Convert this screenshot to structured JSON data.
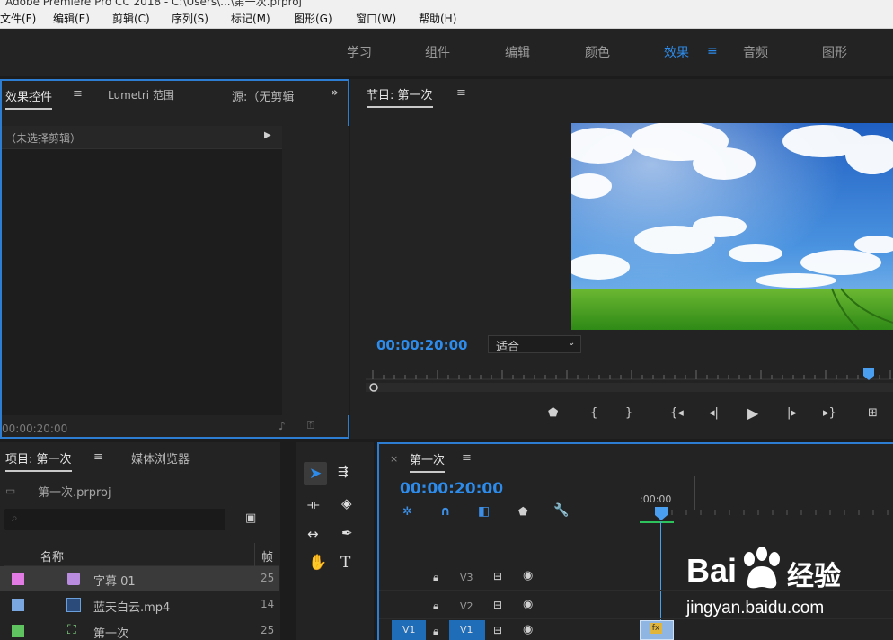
{
  "titlebar": {
    "title": "Adobe Premiere Pro CC 2018 - C:\\Users\\...\\第一次.prproj"
  },
  "menubar": {
    "items": [
      "文件(F)",
      "编辑(E)",
      "剪辑(C)",
      "序列(S)",
      "标记(M)",
      "图形(G)",
      "窗口(W)",
      "帮助(H)"
    ]
  },
  "workspace": {
    "tabs": [
      "学习",
      "组件",
      "编辑",
      "颜色",
      "效果",
      "音频",
      "图形"
    ],
    "active": "效果"
  },
  "effect_controls": {
    "tabs": [
      "效果控件",
      "Lumetri 范围",
      "源:（无剪辑"
    ],
    "row_label": "（未选择剪辑）",
    "timecode": "00:00:20:00"
  },
  "program_monitor": {
    "title": "节目: 第一次",
    "timecode": "00:00:20:00",
    "fit_select": "适合"
  },
  "project": {
    "tabs": [
      "项目: 第一次",
      "媒体浏览器"
    ],
    "file_name": "第一次.prproj",
    "columns": [
      "名称",
      "帧"
    ],
    "items": [
      {
        "name": "字幕 01",
        "rate": "25",
        "color": "#e27be3"
      },
      {
        "name": "蓝天白云.mp4",
        "rate": "14",
        "color": "#7ba7e0"
      },
      {
        "name": "第一次",
        "rate": "25",
        "color": "#5fc35f"
      }
    ]
  },
  "timeline": {
    "title": "第一次",
    "timecode": "00:00:20:00",
    "ruler_label": ":00:00",
    "tracks": [
      {
        "name": "V3"
      },
      {
        "name": "V2"
      },
      {
        "name": "V1",
        "source": "V1"
      }
    ],
    "clip_badge": "fx"
  },
  "watermark": {
    "brand_left": "Bai",
    "brand_right": "经验",
    "url": "jingyan.baidu.com"
  },
  "colors": {
    "accent": "#2d8ceb",
    "panel": "#232323",
    "frame": "#2d7dd2"
  }
}
